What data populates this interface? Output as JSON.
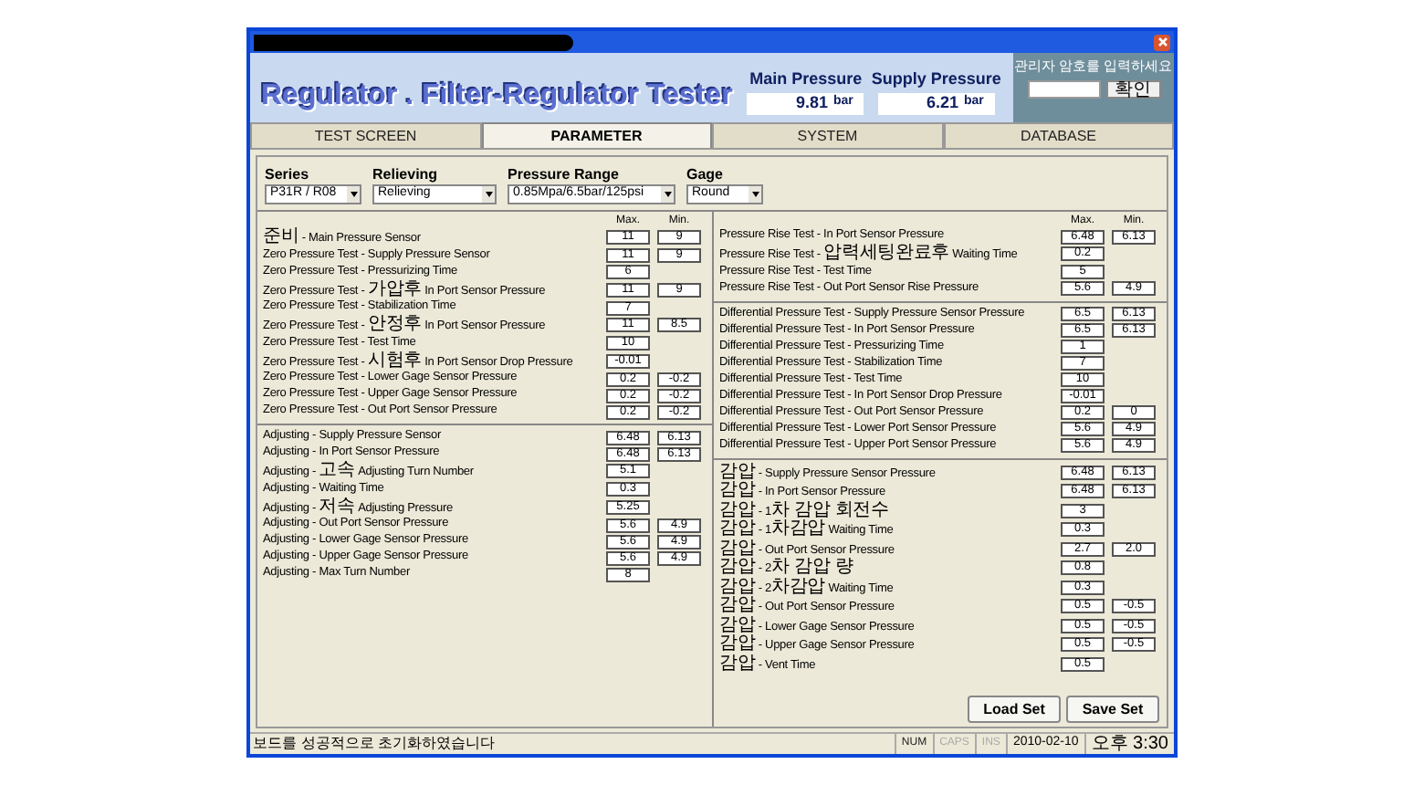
{
  "app_title": "Regulator . Filter-Regulator Tester",
  "readouts": [
    {
      "label": "Main Pressure",
      "value": "9.81",
      "unit": "bar"
    },
    {
      "label": "Supply Pressure",
      "value": "6.21",
      "unit": "bar"
    }
  ],
  "admin": {
    "prompt": "관리자 암호를 입력하세요",
    "button": "확인"
  },
  "tabs": [
    {
      "label": "TEST SCREEN",
      "selected": false
    },
    {
      "label": "PARAMETER",
      "selected": true
    },
    {
      "label": "SYSTEM",
      "selected": false
    },
    {
      "label": "DATABASE",
      "selected": false
    }
  ],
  "selectors": [
    {
      "label": "Series",
      "value": "P31R / R08"
    },
    {
      "label": "Relieving",
      "value": "Relieving"
    },
    {
      "label": "Pressure Range",
      "value": "0.85Mpa/6.5bar/125psi"
    },
    {
      "label": "Gage",
      "value": "Round"
    }
  ],
  "columns": [
    {
      "max_header": "Max.",
      "min_header": "Min.",
      "sections": [
        {
          "rows": [
            {
              "label": "준비 - Main Pressure Sensor",
              "max": "11",
              "min": "9"
            },
            {
              "label": "Zero Pressure Test - Supply Pressure Sensor",
              "max": "11",
              "min": "9"
            },
            {
              "label": "Zero Pressure Test - Pressurizing Time",
              "max": "6"
            },
            {
              "label": "Zero Pressure Test - 가압후 In Port Sensor Pressure",
              "max": "11",
              "min": "9"
            },
            {
              "label": "Zero Pressure Test - Stabilization Time",
              "max": "7"
            },
            {
              "label": "Zero Pressure Test - 안정후 In Port Sensor Pressure",
              "max": "11",
              "min": "8.5"
            },
            {
              "label": "Zero Pressure Test - Test Time",
              "max": "10"
            },
            {
              "label": "Zero Pressure Test - 시험후 In Port Sensor Drop Pressure",
              "max": "-0.01"
            },
            {
              "label": "Zero Pressure Test - Lower Gage Sensor Pressure",
              "max": "0.2",
              "min": "-0.2"
            },
            {
              "label": "Zero Pressure Test - Upper Gage Sensor Pressure",
              "max": "0.2",
              "min": "-0.2"
            },
            {
              "label": "Zero Pressure Test - Out Port Sensor Pressure",
              "max": "0.2",
              "min": "-0.2"
            }
          ]
        },
        {
          "rows": [
            {
              "label": "Adjusting - Supply Pressure Sensor",
              "max": "6.48",
              "min": "6.13"
            },
            {
              "label": "Adjusting - In Port Sensor Pressure",
              "max": "6.48",
              "min": "6.13"
            },
            {
              "label": "Adjusting - 고속 Adjusting Turn Number",
              "max": "5.1"
            },
            {
              "label": "Adjusting - Waiting Time",
              "max": "0.3"
            },
            {
              "label": "Adjusting - 저속 Adjusting Pressure",
              "max": "5.25"
            },
            {
              "label": "Adjusting - Out Port Sensor Pressure",
              "max": "5.6",
              "min": "4.9"
            },
            {
              "label": "Adjusting - Lower Gage Sensor Pressure",
              "max": "5.6",
              "min": "4.9"
            },
            {
              "label": "Adjusting - Upper Gage Sensor Pressure",
              "max": "5.6",
              "min": "4.9"
            },
            {
              "label": "Adjusting - Max Turn Number",
              "max": "8"
            }
          ]
        }
      ]
    },
    {
      "max_header": "Max.",
      "min_header": "Min.",
      "sections": [
        {
          "rows": [
            {
              "label": "Pressure Rise Test - In Port Sensor Pressure",
              "max": "6.48",
              "min": "6.13"
            },
            {
              "label": "Pressure Rise Test - 압력세팅완료후 Waiting Time",
              "max": "0.2"
            },
            {
              "label": "Pressure Rise Test - Test Time",
              "max": "5"
            },
            {
              "label": "Pressure Rise Test - Out Port Sensor Rise Pressure",
              "max": "5.6",
              "min": "4.9"
            }
          ]
        },
        {
          "rows": [
            {
              "label": "Differential Pressure Test - Supply Pressure Sensor Pressure",
              "max": "6.5",
              "min": "6.13"
            },
            {
              "label": "Differential Pressure Test - In Port Sensor Pressure",
              "max": "6.5",
              "min": "6.13"
            },
            {
              "label": "Differential Pressure Test - Pressurizing Time",
              "max": "1"
            },
            {
              "label": "Differential Pressure Test - Stabilization Time",
              "max": "7"
            },
            {
              "label": "Differential Pressure Test - Test Time",
              "max": "10"
            },
            {
              "label": "Differential Pressure Test - In Port Sensor Drop Pressure",
              "max": "-0.01"
            },
            {
              "label": "Differential Pressure Test - Out Port Sensor Pressure",
              "max": "0.2",
              "min": "0"
            },
            {
              "label": "Differential Pressure Test - Lower Port Sensor Pressure",
              "max": "5.6",
              "min": "4.9"
            },
            {
              "label": "Differential Pressure Test - Upper Port Sensor Pressure",
              "max": "5.6",
              "min": "4.9"
            }
          ]
        },
        {
          "rows": [
            {
              "label": "감압 - Supply Pressure Sensor Pressure",
              "max": "6.48",
              "min": "6.13"
            },
            {
              "label": "감압 - In Port Sensor Pressure",
              "max": "6.48",
              "min": "6.13"
            },
            {
              "label": "감압 - 1차 감압 회전수",
              "max": "3"
            },
            {
              "label": "감압 - 1차감압 Waiting Time",
              "max": "0.3"
            },
            {
              "label": "감압 - Out Port Sensor Pressure",
              "max": "2.7",
              "min": "2.0"
            },
            {
              "label": "감압 - 2차 감압 량",
              "max": "0.8"
            },
            {
              "label": "감압 - 2차감압 Waiting Time",
              "max": "0.3"
            },
            {
              "label": "감압 - Out Port Sensor Pressure",
              "max": "0.5",
              "min": "-0.5"
            },
            {
              "label": "감압 - Lower Gage Sensor Pressure",
              "max": "0.5",
              "min": "-0.5"
            },
            {
              "label": "감압 - Upper Gage Sensor Pressure",
              "max": "0.5",
              "min": "-0.5"
            },
            {
              "label": "감압 - Vent Time",
              "max": "0.5"
            }
          ]
        }
      ]
    }
  ],
  "buttons": [
    "Load Set",
    "Save Set"
  ],
  "status_bar": {
    "message": "보드를 성공적으로 초기화하였습니다",
    "indicators": [
      {
        "label": "NUM",
        "disabled": false
      },
      {
        "label": "CAPS",
        "disabled": true
      },
      {
        "label": "INS",
        "disabled": true
      }
    ],
    "date": "2010-02-10",
    "time": "오후 3:30"
  }
}
